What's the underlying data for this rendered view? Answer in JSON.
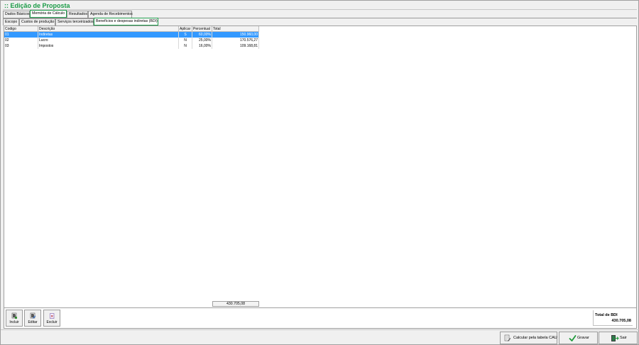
{
  "window": {
    "title": ":: Edição de Proposta"
  },
  "main_tabs": [
    {
      "label": "Dados Básicos",
      "active": false
    },
    {
      "label": "Memória de Cálculo",
      "active": true
    },
    {
      "label": "Resultados",
      "active": false
    },
    {
      "label": "Agenda de Recebimentos",
      "active": false
    }
  ],
  "sub_tabs": [
    {
      "label": "Escopo",
      "active": false
    },
    {
      "label": "Custos de produção",
      "active": false
    },
    {
      "label": "Serviços terceirizados",
      "active": false
    },
    {
      "label": "Benefícios e despesas indiretas (BDI)",
      "active": true
    }
  ],
  "grid": {
    "columns": [
      "Codigo",
      "Descrição",
      "Aplicar",
      "Percentual",
      "Total"
    ],
    "rows": [
      {
        "codigo": "01",
        "descricao": "Indiretas",
        "aplicar": "S",
        "percentual": "60,00%",
        "total": "150.960,00",
        "selected": true
      },
      {
        "codigo": "02",
        "descricao": "Lucro",
        "aplicar": "N",
        "percentual": "25,00%",
        "total": "170.576,27",
        "selected": false
      },
      {
        "codigo": "03",
        "descricao": "Impostos",
        "aplicar": "N",
        "percentual": "16,00%",
        "total": "109.168,81",
        "selected": false
      }
    ],
    "footer_total": "430.705,08"
  },
  "toolbar": {
    "incluir": "Incluir",
    "editar": "Editar",
    "excluir": "Excluir"
  },
  "bdi": {
    "label": "Total de BDI",
    "value": "430.705,08"
  },
  "footer": {
    "calc_label": "Calcular pela tabela CAU",
    "gravar_label": "Gravar",
    "sair_label": "Sair"
  },
  "colors": {
    "accent": "#1a9b46",
    "selection": "#3399ff"
  }
}
